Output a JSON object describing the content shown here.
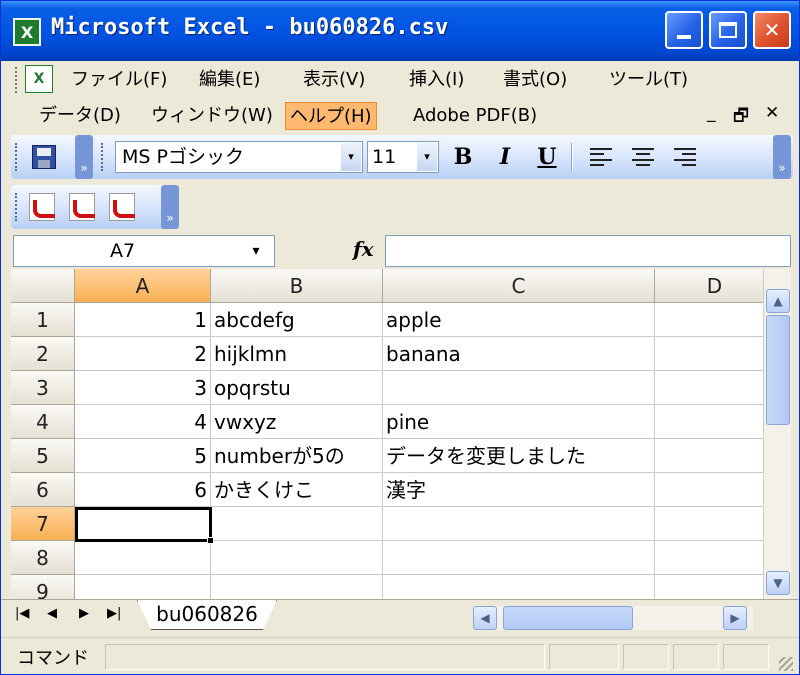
{
  "window": {
    "title": "Microsoft Excel - bu060826.csv",
    "app_icon_glyph": "X",
    "minimize_glyph": "_",
    "close_glyph": "✕"
  },
  "menu": {
    "items": [
      {
        "label": "ファイル(F)"
      },
      {
        "label": "編集(E)"
      },
      {
        "label": "表示(V)"
      },
      {
        "label": "挿入(I)"
      },
      {
        "label": "書式(O)"
      },
      {
        "label": "ツール(T)"
      },
      {
        "label": "データ(D)"
      },
      {
        "label": "ウィンドウ(W)"
      },
      {
        "label": "ヘルプ(H)",
        "active": true
      },
      {
        "label": "Adobe PDF(B)"
      }
    ],
    "doc_controls": {
      "minimize": "_",
      "restore": "🗗",
      "close": "✕"
    }
  },
  "toolbar": {
    "font_name": "MS Pゴシック",
    "font_size": "11",
    "bold": "B",
    "italic": "I",
    "underline": "U",
    "dropdown_arrow": "▾",
    "chevron": "»"
  },
  "formula_bar": {
    "cell_ref": "A7",
    "fx_label": "fx",
    "formula": ""
  },
  "grid": {
    "columns": [
      "A",
      "B",
      "C",
      "D"
    ],
    "selected_column": "A",
    "rows": [
      {
        "num": "1",
        "a": "1",
        "b": "abcdefg",
        "c": "apple"
      },
      {
        "num": "2",
        "a": "2",
        "b": "hijklmn",
        "c": "banana"
      },
      {
        "num": "3",
        "a": "3",
        "b": "opqrstu",
        "c": ""
      },
      {
        "num": "4",
        "a": "4",
        "b": "vwxyz",
        "c": "pine"
      },
      {
        "num": "5",
        "a": "5",
        "b": "numberが5の",
        "c": "データを変更しました"
      },
      {
        "num": "6",
        "a": "6",
        "b": "かきくけこ",
        "c": "漢字"
      },
      {
        "num": "7",
        "a": "",
        "b": "",
        "c": ""
      },
      {
        "num": "8",
        "a": "",
        "b": "",
        "c": ""
      },
      {
        "num": "9",
        "a": "",
        "b": "",
        "c": ""
      }
    ],
    "selected_row": "7"
  },
  "sheet_tabs": {
    "nav": [
      "|◀",
      "◀",
      "▶",
      "▶|"
    ],
    "tabs": [
      "bu060826"
    ]
  },
  "status": {
    "text": "コマンド"
  },
  "colors": {
    "title_bar": "#0054e3",
    "menu_highlight": "#ffb86f",
    "header_selected": "#f9b155",
    "close_button": "#e0512c"
  }
}
